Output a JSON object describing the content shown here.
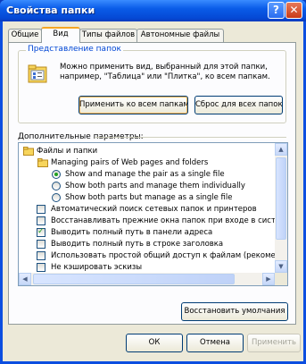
{
  "window": {
    "title": "Свойства папки",
    "help_glyph": "?",
    "close_glyph": "✕"
  },
  "tabs": [
    {
      "label": "Общие"
    },
    {
      "label": "Вид"
    },
    {
      "label": "Типы файлов"
    },
    {
      "label": "Автономные файлы"
    }
  ],
  "folder_views": {
    "group_label": "Представление папок",
    "description": "Можно применить вид, выбранный для этой папки, например, \"Таблица\" или \"Плитка\", ко всем папкам.",
    "apply_button": "Применить ко всем папкам",
    "reset_button": "Сброс для всех папок"
  },
  "advanced": {
    "label": "Дополнительные параметры:",
    "root": "Файлы и папки",
    "subfolder": "Managing pairs of Web pages and folders",
    "options": [
      {
        "type": "radio",
        "checked": true,
        "label": "Show and manage the pair as a single file"
      },
      {
        "type": "radio",
        "checked": false,
        "label": "Show both parts and manage them individually"
      },
      {
        "type": "radio",
        "checked": false,
        "label": "Show both parts but manage as a single file"
      },
      {
        "type": "checkbox",
        "checked": false,
        "label": "Автоматический поиск сетевых папок и принтеров"
      },
      {
        "type": "checkbox",
        "checked": false,
        "label": "Восстанавливать прежние окна папок при входе в систем"
      },
      {
        "type": "checkbox",
        "checked": true,
        "label": "Выводить полный путь в панели адреса"
      },
      {
        "type": "checkbox",
        "checked": false,
        "label": "Выводить полный путь в строке заголовка"
      },
      {
        "type": "checkbox",
        "checked": false,
        "label": "Использовать простой общий доступ к файлам (рекомен"
      },
      {
        "type": "checkbox",
        "checked": false,
        "label": "Не кэшировать эскизы"
      }
    ]
  },
  "restore_defaults_button": "Восстановить умолчания",
  "dialog_buttons": {
    "ok": "ОК",
    "cancel": "Отмена",
    "apply": "Применить"
  }
}
